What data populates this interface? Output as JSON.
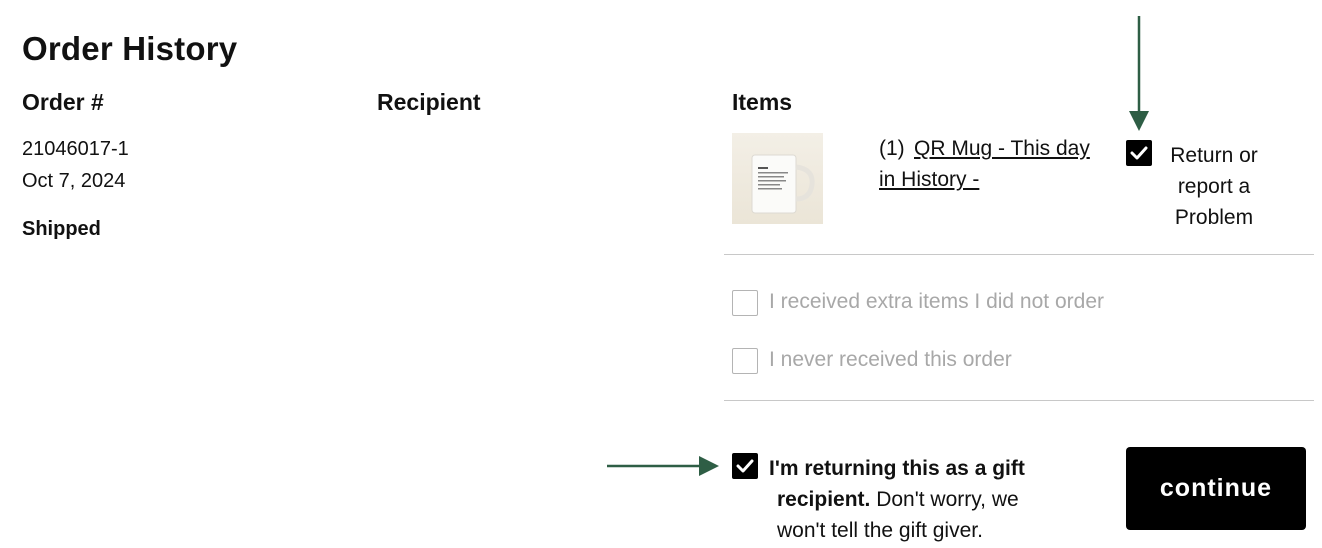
{
  "page": {
    "title": "Order History"
  },
  "columns": {
    "order": "Order #",
    "recipient": "Recipient",
    "items": "Items"
  },
  "order": {
    "number": "21046017-1",
    "date": "Oct 7, 2024",
    "status": "Shipped"
  },
  "item": {
    "quantity": "(1)",
    "name_line1": "QR Mug - This day",
    "name_line2": "in History -",
    "thumbnail": "mug-thumbnail"
  },
  "options": {
    "return_label_line1": "Return or",
    "return_label_line2": "report a",
    "return_label_line3": "Problem",
    "return_checked": true,
    "extra_items_label": "I received extra items I did not order",
    "extra_items_checked": false,
    "never_received_label": "I never received this order",
    "never_received_checked": false,
    "gift_bold_1": "I'm returning this as a gift",
    "gift_bold_2": "recipient.",
    "gift_rest_1": " Don't worry, we",
    "gift_rest_2": "won't tell the gift giver.",
    "gift_checked": true
  },
  "actions": {
    "continue_label": "continue"
  },
  "colors": {
    "annotation_arrow": "#2e5e45",
    "disabled_text": "#a8a8a8",
    "checkbox_checked": "#000000"
  }
}
